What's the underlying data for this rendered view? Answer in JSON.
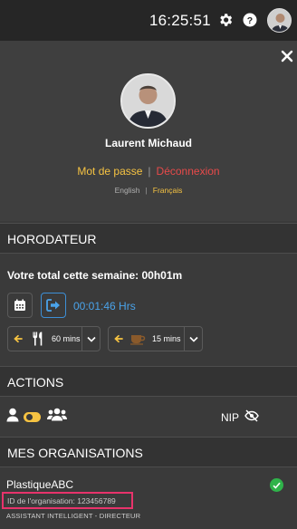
{
  "header": {
    "clock": "16:25:51",
    "icons": [
      "gear-icon",
      "help-icon",
      "user-avatar"
    ]
  },
  "profile": {
    "name": "Laurent Michaud",
    "password_link": "Mot de passe",
    "separator": "|",
    "logout_link": "Déconnexion",
    "languages": [
      {
        "label": "English",
        "active": false
      },
      {
        "label": "Français",
        "active": true
      }
    ]
  },
  "horodateur": {
    "title": "HORODATEUR",
    "week_total": "Votre total cette semaine: 00h01m",
    "timer": "00:01:46 Hrs",
    "breaks": [
      {
        "label": "60 mins",
        "icon": "fork-knife-icon"
      },
      {
        "label": "15 mins",
        "icon": "coffee-icon"
      }
    ]
  },
  "actions": {
    "title": "ACTIONS",
    "nip_label": "NIP"
  },
  "organisations": {
    "title": "MES ORGANISATIONS",
    "items": [
      {
        "name": "PlastiqueABC",
        "org_id": "ID de l'organisation: 123456789",
        "role": "ASSISTANT INTELLIGENT - DIRECTEUR",
        "status": "active"
      }
    ]
  },
  "colors": {
    "accent_yellow": "#f6c342",
    "logout_red": "#e84a4a",
    "timer_blue": "#4aa3ea",
    "highlight_pink": "#e8336b",
    "status_green": "#2fb34a"
  }
}
